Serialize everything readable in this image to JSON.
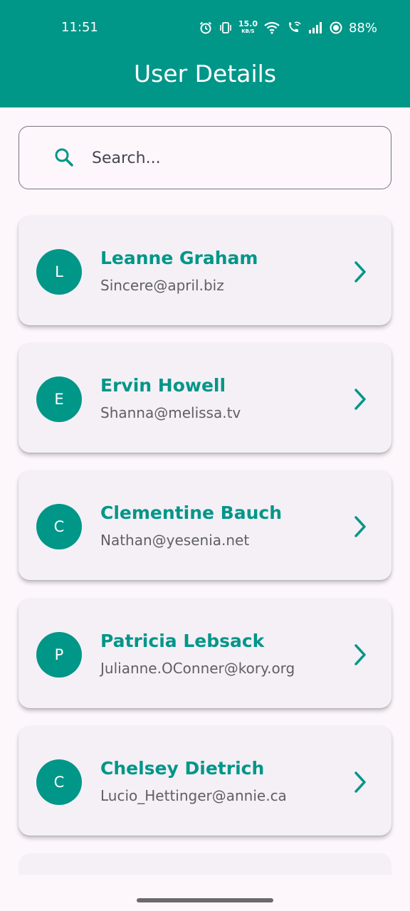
{
  "status_bar": {
    "time": "11:51",
    "net_speed_value": "15.0",
    "net_speed_unit": "KB/S",
    "battery": "88%",
    "icons": [
      "alarm-icon",
      "vibrate-icon",
      "wifi-icon",
      "wifi-call-icon",
      "signal-icon",
      "battery-saver-icon"
    ]
  },
  "app_bar": {
    "title": "User Details",
    "color": "#009688"
  },
  "search": {
    "placeholder": "Search...",
    "value": "",
    "icon": "search-icon"
  },
  "users": [
    {
      "initial": "L",
      "name": "Leanne Graham",
      "email": "Sincere@april.biz"
    },
    {
      "initial": "E",
      "name": "Ervin Howell",
      "email": "Shanna@melissa.tv"
    },
    {
      "initial": "C",
      "name": "Clementine Bauch",
      "email": "Nathan@yesenia.net"
    },
    {
      "initial": "P",
      "name": "Patricia Lebsack",
      "email": "Julianne.OConner@kory.org"
    },
    {
      "initial": "C",
      "name": "Chelsey Dietrich",
      "email": "Lucio_Hettinger@annie.ca"
    }
  ],
  "colors": {
    "accent": "#009688",
    "card_bg": "#f4f0f6",
    "page_bg": "#fdf7fc"
  }
}
